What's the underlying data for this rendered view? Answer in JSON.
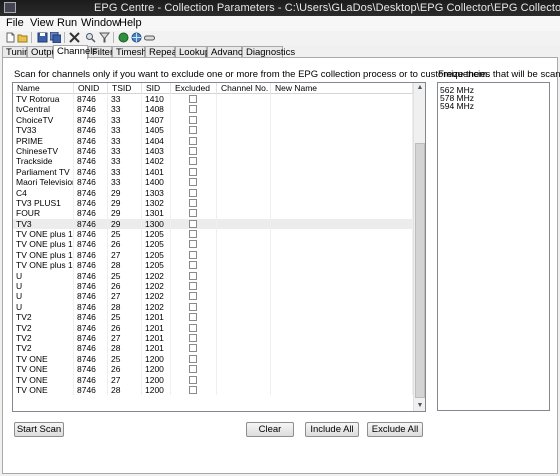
{
  "window": {
    "title": "EPG Centre - Collection Parameters - C:\\Users\\GLaDos\\Desktop\\EPG Collector\\EPG Collector.ini"
  },
  "menu": [
    "File",
    "View",
    "Run",
    "Window",
    "Help"
  ],
  "toolbar": {
    "icons": [
      "new-file-icon",
      "open-folder-icon",
      "save-icon",
      "save-all-icon",
      "delete-icon",
      "find-icon",
      "filter-icon",
      "run-icon",
      "globe-icon",
      "link-icon"
    ]
  },
  "tabs": [
    "Tuning",
    "Output",
    "Channels",
    "Filters",
    "Timeshift",
    "Repeats",
    "Lookups",
    "Advanced",
    "Diagnostics"
  ],
  "active_tab": "Channels",
  "channels": {
    "instruction": "Scan for channels only if you want to exclude one or more from the EPG collection process or to customize them.",
    "columns": [
      "Name",
      "ONID",
      "TSID",
      "SID",
      "Excluded",
      "Channel No.",
      "New Name"
    ],
    "rows": [
      [
        "TV Rotorua",
        "8746",
        "33",
        "1410"
      ],
      [
        "tvCentral",
        "8746",
        "33",
        "1408"
      ],
      [
        "ChoiceTV",
        "8746",
        "33",
        "1407"
      ],
      [
        "TV33",
        "8746",
        "33",
        "1405"
      ],
      [
        "PRIME",
        "8746",
        "33",
        "1404"
      ],
      [
        "ChineseTV",
        "8746",
        "33",
        "1403"
      ],
      [
        "Trackside",
        "8746",
        "33",
        "1402"
      ],
      [
        "Parliament TV",
        "8746",
        "33",
        "1401"
      ],
      [
        "Maori Television",
        "8746",
        "33",
        "1400"
      ],
      [
        "C4",
        "8746",
        "29",
        "1303"
      ],
      [
        "TV3 PLUS1",
        "8746",
        "29",
        "1302"
      ],
      [
        "FOUR",
        "8746",
        "29",
        "1301"
      ],
      [
        "TV3",
        "8746",
        "29",
        "1300"
      ],
      [
        "TV ONE plus 1",
        "8746",
        "25",
        "1205"
      ],
      [
        "TV ONE plus 1",
        "8746",
        "26",
        "1205"
      ],
      [
        "TV ONE plus 1",
        "8746",
        "27",
        "1205"
      ],
      [
        "TV ONE plus 1",
        "8746",
        "28",
        "1205"
      ],
      [
        "U",
        "8746",
        "25",
        "1202"
      ],
      [
        "U",
        "8746",
        "26",
        "1202"
      ],
      [
        "U",
        "8746",
        "27",
        "1202"
      ],
      [
        "U",
        "8746",
        "28",
        "1202"
      ],
      [
        "TV2",
        "8746",
        "25",
        "1201"
      ],
      [
        "TV2",
        "8746",
        "26",
        "1201"
      ],
      [
        "TV2",
        "8746",
        "27",
        "1201"
      ],
      [
        "TV2",
        "8746",
        "28",
        "1201"
      ],
      [
        "TV ONE",
        "8746",
        "25",
        "1200"
      ],
      [
        "TV ONE",
        "8746",
        "26",
        "1200"
      ],
      [
        "TV ONE",
        "8746",
        "27",
        "1200"
      ],
      [
        "TV ONE",
        "8746",
        "28",
        "1200"
      ]
    ],
    "selected_row": 12
  },
  "frequencies": {
    "label": "Frequencies that will be scanned",
    "items": [
      "562 MHz",
      "578 MHz",
      "594 MHz"
    ]
  },
  "buttons": {
    "start_scan": "Start Scan",
    "clear": "Clear",
    "include_all": "Include All",
    "exclude_all": "Exclude All"
  },
  "scrollbar": {
    "up_glyph": "▲",
    "down_glyph": "▼"
  }
}
